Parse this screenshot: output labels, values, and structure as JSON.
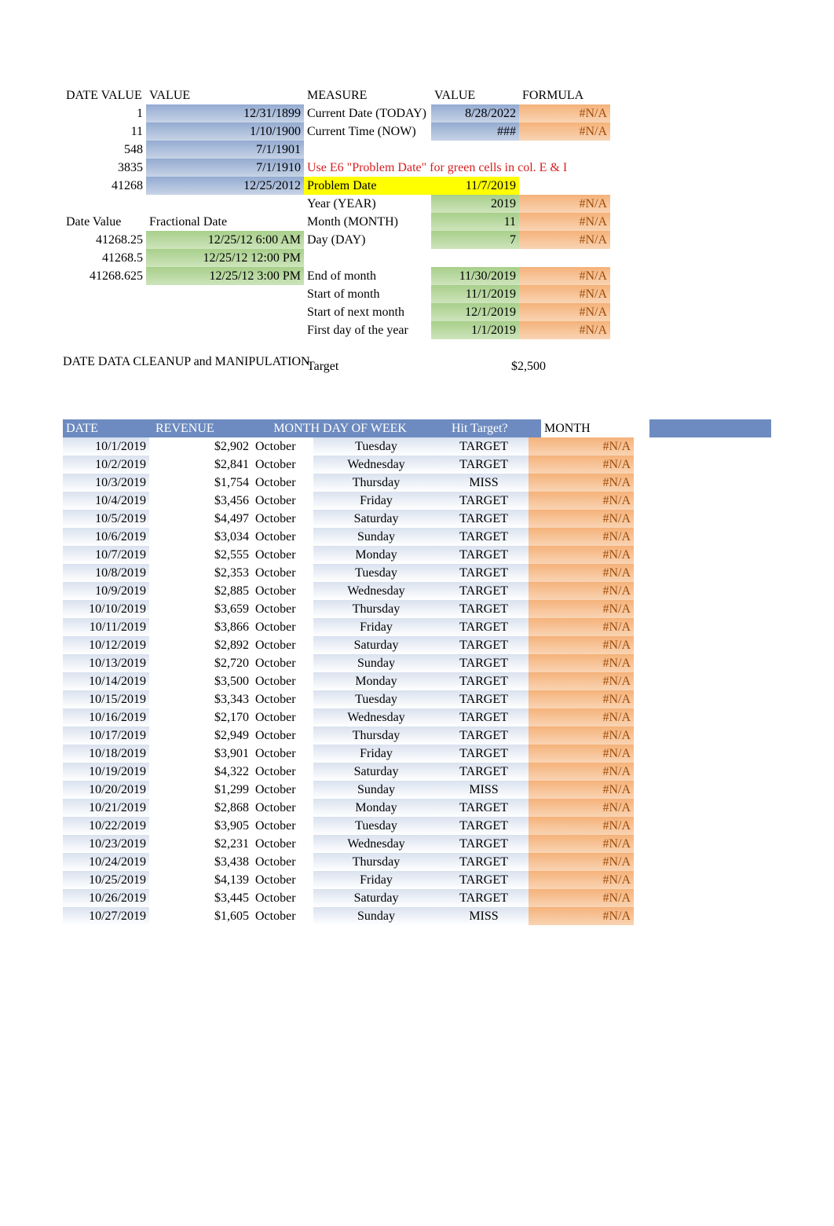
{
  "top_left": {
    "headers": {
      "date_value": "DATE VALUE",
      "value": "VALUE"
    },
    "rows": [
      {
        "dv": "1",
        "val": "12/31/1899"
      },
      {
        "dv": "11",
        "val": "1/10/1900"
      },
      {
        "dv": "548",
        "val": "7/1/1901"
      },
      {
        "dv": "3835",
        "val": "7/1/1910"
      },
      {
        "dv": "41268",
        "val": "12/25/2012"
      }
    ]
  },
  "frac": {
    "headers": {
      "date_value": "Date Value",
      "frac": "Fractional Date"
    },
    "rows": [
      {
        "dv": "41268.25",
        "fd": "12/25/12 6:00 AM"
      },
      {
        "dv": "41268.5",
        "fd": "12/25/12 12:00 PM"
      },
      {
        "dv": "41268.625",
        "fd": "12/25/12 3:00 PM"
      }
    ]
  },
  "top_right": {
    "headers": {
      "measure": "MEASURE",
      "value": "VALUE",
      "formula": "FORMULA"
    },
    "rows1": [
      {
        "m": "Current Date (TODAY)",
        "v": "8/28/2022",
        "f": "#N/A"
      },
      {
        "m": "Current Time (NOW)",
        "v": "###",
        "f": "#N/A"
      }
    ],
    "red_note": "Use E6 \"Problem Date\" for green cells in col. E & I",
    "problem": {
      "label": "Problem Date",
      "value": "11/7/2019"
    },
    "rows2": [
      {
        "m": "Year (YEAR)",
        "v": "2019",
        "f": "#N/A"
      },
      {
        "m": "Month (MONTH)",
        "v": "11",
        "f": "#N/A"
      },
      {
        "m": "Day (DAY)",
        "v": "7",
        "f": "#N/A"
      }
    ],
    "rows3": [
      {
        "m": "End of month",
        "v": "11/30/2019",
        "f": "#N/A"
      },
      {
        "m": "Start of month",
        "v": "11/1/2019",
        "f": "#N/A"
      },
      {
        "m": "Start of next month",
        "v": "12/1/2019",
        "f": "#N/A"
      },
      {
        "m": "First day of the year",
        "v": "1/1/2019",
        "f": "#N/A"
      }
    ],
    "target": {
      "label": "Target",
      "value": "$2,500"
    }
  },
  "section_title": "DATE DATA CLEANUP and MANIPULATION",
  "table": {
    "headers": {
      "date": "DATE",
      "revenue": "REVENUE",
      "month": "MONTH",
      "dow": "DAY OF WEEK",
      "hit": "Hit Target?",
      "month2": "MONTH"
    },
    "rows": [
      {
        "date": "10/1/2019",
        "rev": "$2,902",
        "mon": "October",
        "dow": "Tuesday",
        "hit": "TARGET",
        "m2": "#N/A"
      },
      {
        "date": "10/2/2019",
        "rev": "$2,841",
        "mon": "October",
        "dow": "Wednesday",
        "hit": "TARGET",
        "m2": "#N/A"
      },
      {
        "date": "10/3/2019",
        "rev": "$1,754",
        "mon": "October",
        "dow": "Thursday",
        "hit": "MISS",
        "m2": "#N/A"
      },
      {
        "date": "10/4/2019",
        "rev": "$3,456",
        "mon": "October",
        "dow": "Friday",
        "hit": "TARGET",
        "m2": "#N/A"
      },
      {
        "date": "10/5/2019",
        "rev": "$4,497",
        "mon": "October",
        "dow": "Saturday",
        "hit": "TARGET",
        "m2": "#N/A"
      },
      {
        "date": "10/6/2019",
        "rev": "$3,034",
        "mon": "October",
        "dow": "Sunday",
        "hit": "TARGET",
        "m2": "#N/A"
      },
      {
        "date": "10/7/2019",
        "rev": "$2,555",
        "mon": "October",
        "dow": "Monday",
        "hit": "TARGET",
        "m2": "#N/A"
      },
      {
        "date": "10/8/2019",
        "rev": "$2,353",
        "mon": "October",
        "dow": "Tuesday",
        "hit": "TARGET",
        "m2": "#N/A"
      },
      {
        "date": "10/9/2019",
        "rev": "$2,885",
        "mon": "October",
        "dow": "Wednesday",
        "hit": "TARGET",
        "m2": "#N/A"
      },
      {
        "date": "10/10/2019",
        "rev": "$3,659",
        "mon": "October",
        "dow": "Thursday",
        "hit": "TARGET",
        "m2": "#N/A"
      },
      {
        "date": "10/11/2019",
        "rev": "$3,866",
        "mon": "October",
        "dow": "Friday",
        "hit": "TARGET",
        "m2": "#N/A"
      },
      {
        "date": "10/12/2019",
        "rev": "$2,892",
        "mon": "October",
        "dow": "Saturday",
        "hit": "TARGET",
        "m2": "#N/A"
      },
      {
        "date": "10/13/2019",
        "rev": "$2,720",
        "mon": "October",
        "dow": "Sunday",
        "hit": "TARGET",
        "m2": "#N/A"
      },
      {
        "date": "10/14/2019",
        "rev": "$3,500",
        "mon": "October",
        "dow": "Monday",
        "hit": "TARGET",
        "m2": "#N/A"
      },
      {
        "date": "10/15/2019",
        "rev": "$3,343",
        "mon": "October",
        "dow": "Tuesday",
        "hit": "TARGET",
        "m2": "#N/A"
      },
      {
        "date": "10/16/2019",
        "rev": "$2,170",
        "mon": "October",
        "dow": "Wednesday",
        "hit": "TARGET",
        "m2": "#N/A"
      },
      {
        "date": "10/17/2019",
        "rev": "$2,949",
        "mon": "October",
        "dow": "Thursday",
        "hit": "TARGET",
        "m2": "#N/A"
      },
      {
        "date": "10/18/2019",
        "rev": "$3,901",
        "mon": "October",
        "dow": "Friday",
        "hit": "TARGET",
        "m2": "#N/A"
      },
      {
        "date": "10/19/2019",
        "rev": "$4,322",
        "mon": "October",
        "dow": "Saturday",
        "hit": "TARGET",
        "m2": "#N/A"
      },
      {
        "date": "10/20/2019",
        "rev": "$1,299",
        "mon": "October",
        "dow": "Sunday",
        "hit": "MISS",
        "m2": "#N/A"
      },
      {
        "date": "10/21/2019",
        "rev": "$2,868",
        "mon": "October",
        "dow": "Monday",
        "hit": "TARGET",
        "m2": "#N/A"
      },
      {
        "date": "10/22/2019",
        "rev": "$3,905",
        "mon": "October",
        "dow": "Tuesday",
        "hit": "TARGET",
        "m2": "#N/A"
      },
      {
        "date": "10/23/2019",
        "rev": "$2,231",
        "mon": "October",
        "dow": "Wednesday",
        "hit": "TARGET",
        "m2": "#N/A"
      },
      {
        "date": "10/24/2019",
        "rev": "$3,438",
        "mon": "October",
        "dow": "Thursday",
        "hit": "TARGET",
        "m2": "#N/A"
      },
      {
        "date": "10/25/2019",
        "rev": "$4,139",
        "mon": "October",
        "dow": "Friday",
        "hit": "TARGET",
        "m2": "#N/A"
      },
      {
        "date": "10/26/2019",
        "rev": "$3,445",
        "mon": "October",
        "dow": "Saturday",
        "hit": "TARGET",
        "m2": "#N/A"
      },
      {
        "date": "10/27/2019",
        "rev": "$1,605",
        "mon": "October",
        "dow": "Sunday",
        "hit": "MISS",
        "m2": "#N/A"
      }
    ]
  }
}
